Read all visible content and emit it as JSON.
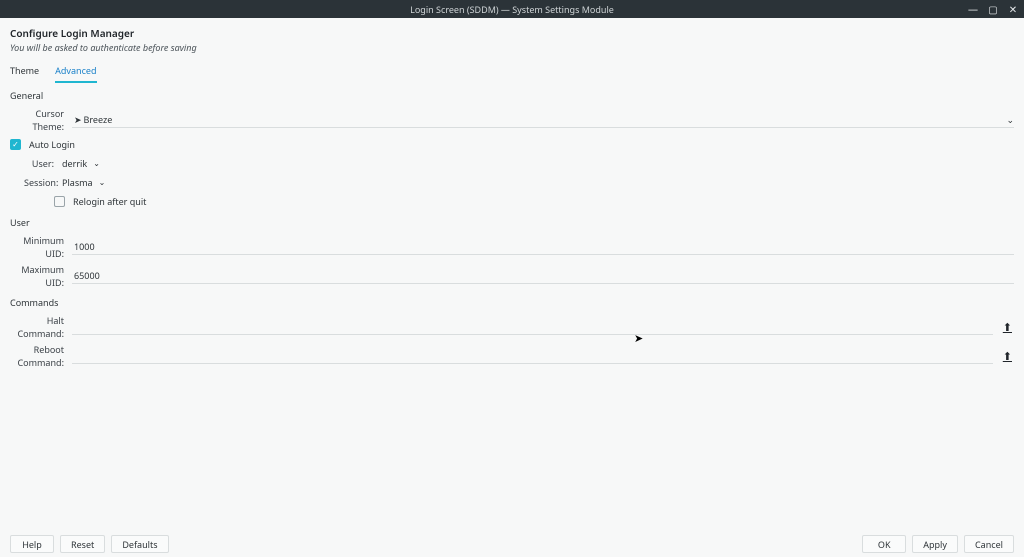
{
  "window": {
    "title": "Login Screen (SDDM) — System Settings Module",
    "controls": {
      "min": "—",
      "max": "▢",
      "close": "✕"
    }
  },
  "header": {
    "title": "Configure Login Manager",
    "subtitle": "You will be asked to authenticate before saving"
  },
  "tabs": {
    "theme": "Theme",
    "advanced": "Advanced"
  },
  "sections": {
    "general": "General",
    "user": "User",
    "commands": "Commands"
  },
  "general": {
    "cursor_theme_label": "Cursor Theme:",
    "cursor_theme_value": "Breeze",
    "auto_login_label": "Auto Login",
    "user_label": "User:",
    "user_value": "derrik",
    "session_label": "Session:",
    "session_value": "Plasma",
    "relogin_label": "Relogin after quit"
  },
  "user": {
    "min_uid_label": "Minimum UID:",
    "min_uid_value": "1000",
    "max_uid_label": "Maximum UID:",
    "max_uid_value": "65000"
  },
  "commands": {
    "halt_label": "Halt Command:",
    "halt_value": "",
    "reboot_label": "Reboot Command:",
    "reboot_value": ""
  },
  "footer": {
    "help": "Help",
    "reset": "Reset",
    "defaults": "Defaults",
    "ok": "OK",
    "apply": "Apply",
    "cancel": "Cancel"
  }
}
